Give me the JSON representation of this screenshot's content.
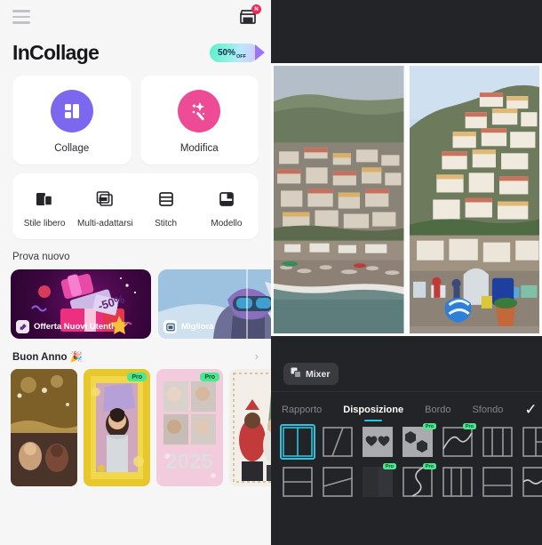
{
  "left_panel": {
    "header": {
      "menu_icon": "hamburger-menu-icon",
      "shop_icon": "shop-store-icon",
      "shop_badge_count": "N"
    },
    "brand": "InCollage",
    "promo_badge": {
      "percent": "50%",
      "off_label": "OFF"
    },
    "main_cards": [
      {
        "label": "Collage",
        "icon": "collage-grid-icon",
        "color": "#7b68ee"
      },
      {
        "label": "Modifica",
        "icon": "magic-wand-icon",
        "color": "#ee4b96"
      }
    ],
    "tools": [
      {
        "label": "Stile libero",
        "icon": "freestyle-layers-icon"
      },
      {
        "label": "Multi-adattarsi",
        "icon": "multi-fit-icon"
      },
      {
        "label": "Stitch",
        "icon": "stitch-rows-icon"
      },
      {
        "label": "Modello",
        "icon": "template-icon"
      }
    ],
    "try_new": {
      "title": "Prova nuovo",
      "cards": [
        {
          "label": "Offerta Nuovi Utenti",
          "icon": "gift-tag-icon",
          "discount": "-50%"
        },
        {
          "label": "Migliora",
          "icon": "enhance-picture-icon"
        }
      ]
    },
    "new_year": {
      "title": "Buon Anno 🎉",
      "chevron_icon": "chevron-right-icon",
      "templates": [
        {
          "name": "gold-sparkle-dinner",
          "pro": false
        },
        {
          "name": "gold-glitter-celebration",
          "pro": true,
          "pro_label": "Pro"
        },
        {
          "name": "pink-glitter-2025-grid",
          "pro": true,
          "pro_label": "Pro"
        },
        {
          "name": "christmas-family-portrait",
          "pro": false
        }
      ]
    }
  },
  "right_panel": {
    "canvas": {
      "photos": [
        {
          "name": "positano-beach-left"
        },
        {
          "name": "positano-hillside-right"
        }
      ]
    },
    "mixer_button": {
      "label": "Mixer",
      "icon": "mixer-shuffle-icon"
    },
    "tabs": [
      {
        "label": "Rapporto",
        "active": false
      },
      {
        "label": "Disposizione",
        "active": true
      },
      {
        "label": "Bordo",
        "active": false
      },
      {
        "label": "Sfondo",
        "active": false
      }
    ],
    "confirm_icon": "checkmark-icon",
    "accent_color": "#2bc4df",
    "pro_color": "#4ce88f",
    "layouts": [
      {
        "name": "two-vertical-split",
        "selected": true,
        "pro": false
      },
      {
        "name": "diagonal-two-split",
        "selected": false,
        "pro": false
      },
      {
        "name": "two-hearts-shape",
        "selected": false,
        "pro": false
      },
      {
        "name": "two-hexagon-shape",
        "selected": false,
        "pro": true,
        "pro_label": "Pro"
      },
      {
        "name": "s-curve-split",
        "selected": false,
        "pro": true,
        "pro_label": "Pro"
      },
      {
        "name": "three-vertical-split",
        "selected": false,
        "pro": false
      },
      {
        "name": "left-big-right-stack",
        "selected": false,
        "pro": false
      },
      {
        "name": "two-horizontal-split",
        "selected": false,
        "pro": false
      },
      {
        "name": "angled-horizontal-split",
        "selected": false,
        "pro": false
      },
      {
        "name": "circle-corner-shape",
        "selected": false,
        "pro": true,
        "pro_label": "Pro"
      },
      {
        "name": "s-wave-vertical",
        "selected": false,
        "pro": true,
        "pro_label": "Pro"
      },
      {
        "name": "three-uneven-vertical",
        "selected": false,
        "pro": false
      },
      {
        "name": "top-big-bottom-split",
        "selected": false,
        "pro": false
      },
      {
        "name": "wavy-horizontal-split",
        "selected": false,
        "pro": false
      }
    ]
  }
}
